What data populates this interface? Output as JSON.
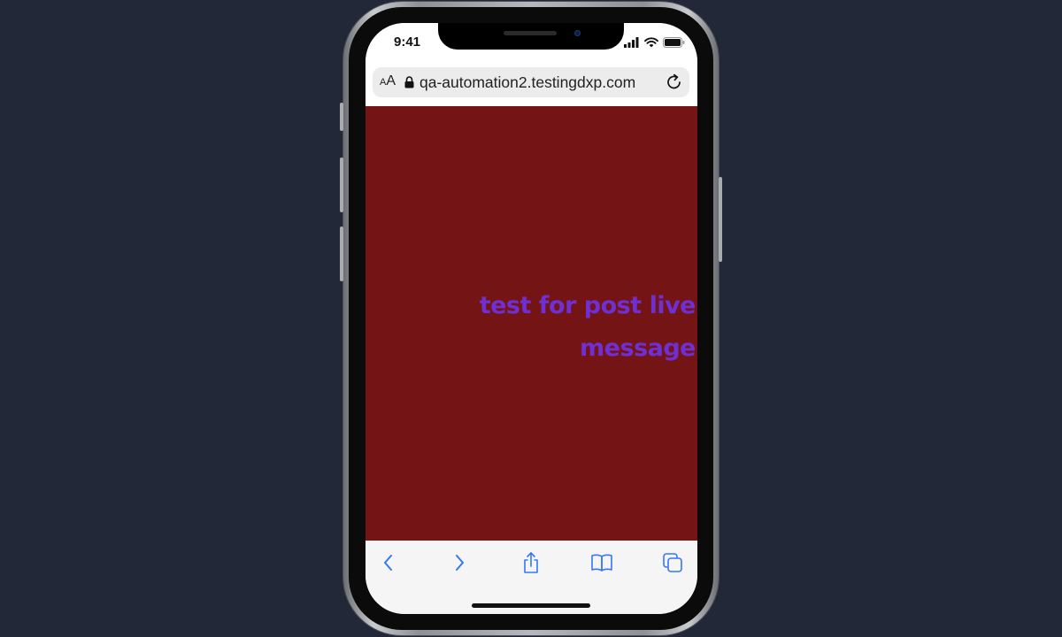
{
  "status_bar": {
    "time": "9:41"
  },
  "address_bar": {
    "text_size_small": "A",
    "text_size_large": "A",
    "url": "qa-automation2.testingdxp.com"
  },
  "content": {
    "message_line1": "test For post live",
    "message_line2": "message",
    "background_color": "#741414",
    "text_color": "#6e2fd3"
  },
  "toolbar": {
    "icons": [
      "back-icon",
      "forward-icon",
      "share-icon",
      "bookmarks-icon",
      "tabs-icon"
    ],
    "accent_color": "#3478f6"
  },
  "page_background": "#222837"
}
